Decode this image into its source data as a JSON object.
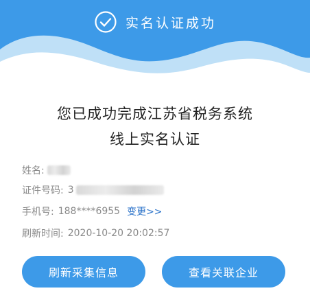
{
  "header": {
    "title": "实名认证成功",
    "icon": "check-circle-icon",
    "background_color": "#3d9ae8"
  },
  "headline": {
    "line1": "您已成功完成江苏省税务系统",
    "line2": "线上实名认证"
  },
  "info": {
    "name_label": "姓名:",
    "id_label": "证件号码:",
    "id_prefix": "3",
    "phone_label": "手机号:",
    "phone_value": "188****6955",
    "change_link": "变更>>",
    "refresh_time_label": "刷新时间:",
    "refresh_time_value": "2020-10-20 20:02:57"
  },
  "buttons": {
    "refresh_label": "刷新采集信息",
    "view_label": "查看关联企业"
  },
  "colors": {
    "accent": "#3d9ae8",
    "link": "#2a72c9"
  }
}
